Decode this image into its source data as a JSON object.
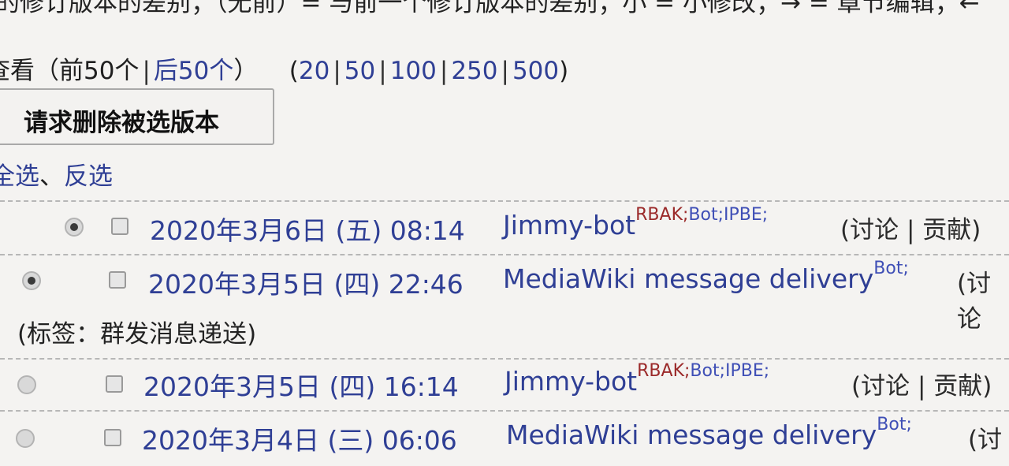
{
  "top_line": "的修订版本的差别；（无前）= 与前一个修订版本的差别；小 = 小修改；→ = 章节编辑；←",
  "view": {
    "label": "查看",
    "prev": "前50个",
    "next": "后50个",
    "limits": [
      "20",
      "50",
      "100",
      "250",
      "500"
    ]
  },
  "delete_button": "请求删除被选版本",
  "selection": {
    "select_all": "全选",
    "separator": "、",
    "invert": "反选"
  },
  "revisions": [
    {
      "date": "2020年3月6日 (五) 08:14",
      "user": "Jimmy-bot",
      "flags_rbak": "RBAK;",
      "flags_other": "Bot;IPBE;",
      "talk": "(讨论 | 贡献)",
      "radio_checked": true
    },
    {
      "date": "2020年3月5日 (四) 22:46",
      "user": "MediaWiki message delivery",
      "flags_rbak": "",
      "flags_other": "Bot;",
      "talk": "(讨论",
      "radio_checked": true,
      "tag": "(标签：群发消息递送)"
    },
    {
      "date": "2020年3月5日 (四) 16:14",
      "user": "Jimmy-bot",
      "flags_rbak": "RBAK;",
      "flags_other": "Bot;IPBE;",
      "talk": "(讨论 | 贡献)",
      "radio_checked": false
    },
    {
      "date": "2020年3月4日 (三) 06:06",
      "user": "MediaWiki message delivery",
      "flags_rbak": "",
      "flags_other": "Bot;",
      "talk": "(讨",
      "radio_checked": false
    }
  ]
}
